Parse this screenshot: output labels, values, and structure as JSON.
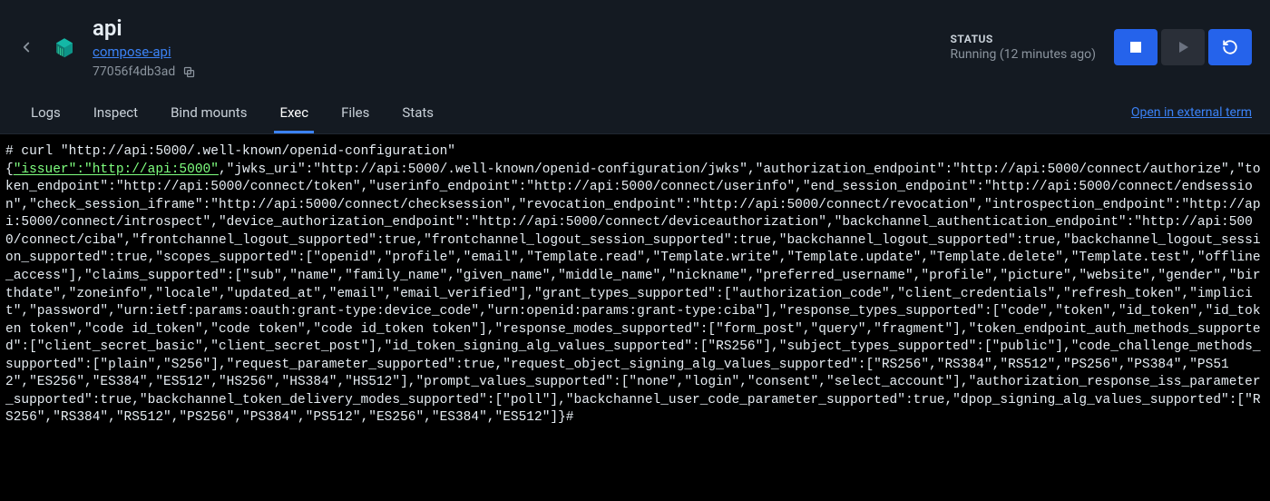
{
  "header": {
    "title": "api",
    "compose_link": "compose-api",
    "container_id": "77056f4db3ad"
  },
  "status": {
    "label": "STATUS",
    "text": "Running (12 minutes ago)"
  },
  "tabs": {
    "items": [
      "Logs",
      "Inspect",
      "Bind mounts",
      "Exec",
      "Files",
      "Stats"
    ],
    "active_index": 3,
    "external_link": "Open in external term"
  },
  "terminal": {
    "prompt_line": "# curl \"http://api:5000/.well-known/openid-configuration\"",
    "highlight": "\"issuer\":\"http://api:5000\"",
    "body": ",\"jwks_uri\":\"http://api:5000/.well-known/openid-configuration/jwks\",\"authorization_endpoint\":\"http://api:5000/connect/authorize\",\"token_endpoint\":\"http://api:5000/connect/token\",\"userinfo_endpoint\":\"http://api:5000/connect/userinfo\",\"end_session_endpoint\":\"http://api:5000/connect/endsession\",\"check_session_iframe\":\"http://api:5000/connect/checksession\",\"revocation_endpoint\":\"http://api:5000/connect/revocation\",\"introspection_endpoint\":\"http://api:5000/connect/introspect\",\"device_authorization_endpoint\":\"http://api:5000/connect/deviceauthorization\",\"backchannel_authentication_endpoint\":\"http://api:5000/connect/ciba\",\"frontchannel_logout_supported\":true,\"frontchannel_logout_session_supported\":true,\"backchannel_logout_supported\":true,\"backchannel_logout_session_supported\":true,\"scopes_supported\":[\"openid\",\"profile\",\"email\",\"Template.read\",\"Template.write\",\"Template.update\",\"Template.delete\",\"Template.test\",\"offline_access\"],\"claims_supported\":[\"sub\",\"name\",\"family_name\",\"given_name\",\"middle_name\",\"nickname\",\"preferred_username\",\"profile\",\"picture\",\"website\",\"gender\",\"birthdate\",\"zoneinfo\",\"locale\",\"updated_at\",\"email\",\"email_verified\"],\"grant_types_supported\":[\"authorization_code\",\"client_credentials\",\"refresh_token\",\"implicit\",\"password\",\"urn:ietf:params:oauth:grant-type:device_code\",\"urn:openid:params:grant-type:ciba\"],\"response_types_supported\":[\"code\",\"token\",\"id_token\",\"id_token token\",\"code id_token\",\"code token\",\"code id_token token\"],\"response_modes_supported\":[\"form_post\",\"query\",\"fragment\"],\"token_endpoint_auth_methods_supported\":[\"client_secret_basic\",\"client_secret_post\"],\"id_token_signing_alg_values_supported\":[\"RS256\"],\"subject_types_supported\":[\"public\"],\"code_challenge_methods_supported\":[\"plain\",\"S256\"],\"request_parameter_supported\":true,\"request_object_signing_alg_values_supported\":[\"RS256\",\"RS384\",\"RS512\",\"PS256\",\"PS384\",\"PS512\",\"ES256\",\"ES384\",\"ES512\",\"HS256\",\"HS384\",\"HS512\"],\"prompt_values_supported\":[\"none\",\"login\",\"consent\",\"select_account\"],\"authorization_response_iss_parameter_supported\":true,\"backchannel_token_delivery_modes_supported\":[\"poll\"],\"backchannel_user_code_parameter_supported\":true,\"dpop_signing_alg_values_supported\":[\"RS256\",\"RS384\",\"RS512\",\"PS256\",\"PS384\",\"PS512\",\"ES256\",\"ES384\",\"ES512\"]}#"
  }
}
